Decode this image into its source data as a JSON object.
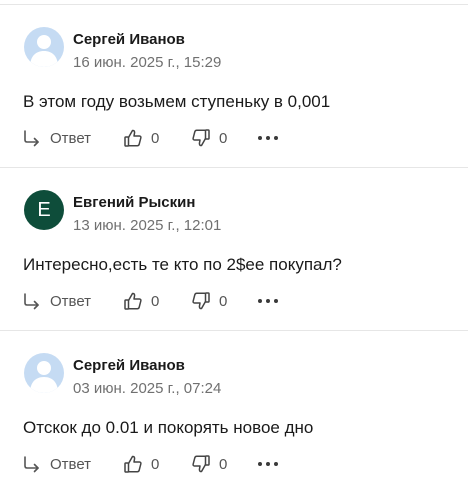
{
  "comments": [
    {
      "author": "Сергей Иванов",
      "date": "16 июн. 2025 г., 15:29",
      "text": "В этом году возьмем ступеньку в 0,001",
      "avatar": {
        "type": "photo",
        "color": "#c5dbf3",
        "letter": ""
      },
      "reply_label": "Ответ",
      "likes": "0",
      "dislikes": "0"
    },
    {
      "author": "Евгений Рыскин",
      "date": "13 июн. 2025 г., 12:01",
      "text": "Интересно,есть те кто по 2$ee покупал?",
      "avatar": {
        "type": "letter",
        "color": "#0e4d3a",
        "letter": "E"
      },
      "reply_label": "Ответ",
      "likes": "0",
      "dislikes": "0"
    },
    {
      "author": "Сергей Иванов",
      "date": "03 июн. 2025 г., 07:24",
      "text": "Отскок до 0.01 и покорять новое дно",
      "avatar": {
        "type": "photo",
        "color": "#c5dbf3",
        "letter": ""
      },
      "reply_label": "Ответ",
      "likes": "0",
      "dislikes": "0"
    }
  ],
  "icons": {
    "reply": "reply-arrow-icon",
    "like": "thumbs-up-icon",
    "dislike": "thumbs-down-icon",
    "more": "more-dots-icon",
    "avatar": "user-silhouette-icon"
  },
  "colors": {
    "divider": "#e6e6e6",
    "secondary_text": "#707070",
    "avatar_photo": "#c5dbf3",
    "avatar_letter": "#0e4d3a"
  }
}
